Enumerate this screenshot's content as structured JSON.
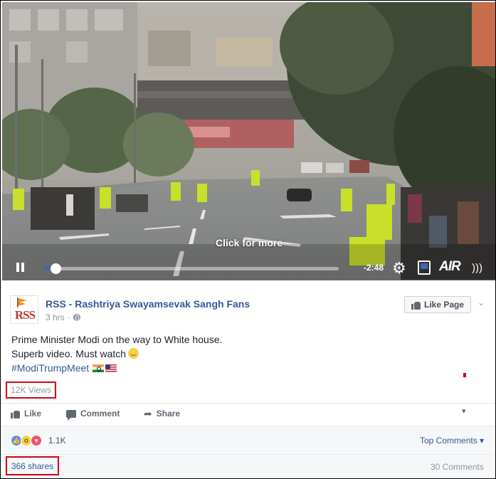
{
  "video": {
    "overlay_text": "Click for more",
    "time_remaining": "-2:48",
    "progress_fraction": 0.04,
    "logo_text": "AIR",
    "accent_color": "#4267b2"
  },
  "post": {
    "page_logo_text": "RSS",
    "page_name": "RSS - Rashtriya Swayamsevak Sangh Fans",
    "timestamp": "3 hrs",
    "like_page_label": "Like Page",
    "text_lines": [
      "Prime Minister Modi on the way to White house.",
      "Superb video. Must watch"
    ],
    "hashtag": "#ModiTrumpMeet",
    "views": "12K Views"
  },
  "actions": {
    "like_label": "Like",
    "comment_label": "Comment",
    "share_label": "Share"
  },
  "reactions": {
    "count": "1.1K",
    "top_comments_label": "Top Comments",
    "shares": "366 shares",
    "comments": "30 Comments"
  },
  "icons": [
    "play-pause-icon",
    "gear-icon",
    "hd-icon",
    "volume-icon",
    "globe-icon",
    "like-icon",
    "comment-icon",
    "share-icon",
    "smile-emoji-icon",
    "india-flag-icon",
    "us-flag-icon"
  ],
  "colors": {
    "link": "#365899",
    "highlight_box": "#d0021b",
    "bar_bg": "#f6f7f9"
  }
}
